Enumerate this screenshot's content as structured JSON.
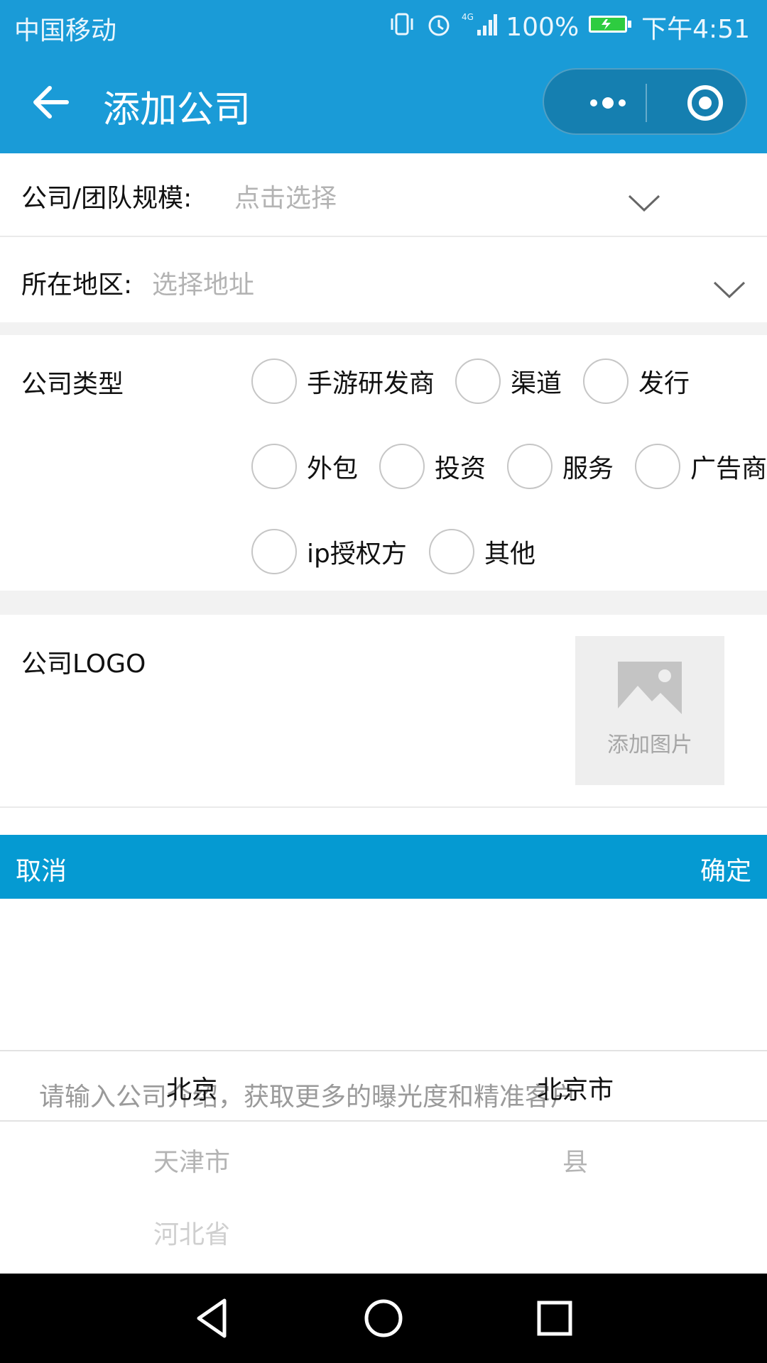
{
  "status_bar": {
    "carrier": "中国移动",
    "battery": "100%",
    "time": "下午4:51",
    "network": "4G",
    "colors": {
      "bar": "#1a9bd7",
      "battery_fill": "#2ecc40"
    },
    "icons": [
      "vibrate-icon",
      "alarm-icon",
      "signal-icon",
      "battery-icon"
    ]
  },
  "navbar": {
    "title": "添加公司",
    "icons": [
      "back-arrow-icon",
      "more-dots-icon",
      "close-target-icon"
    ]
  },
  "form": {
    "scale": {
      "label": "公司/团队规模:",
      "placeholder": "点击选择"
    },
    "region": {
      "label": "所在地区:",
      "placeholder": "选择地址"
    },
    "company_type": {
      "label": "公司类型",
      "options": [
        "手游研发商",
        "渠道",
        "发行",
        "外包",
        "投资",
        "服务",
        "广告商",
        "ip授权方",
        "其他"
      ]
    },
    "logo": {
      "label": "公司LOGO",
      "upload_text": "添加图片"
    },
    "intro_placeholder": "请输入公司介绍，获取更多的曝光度和精准客户"
  },
  "picker": {
    "cancel": "取消",
    "confirm": "确定",
    "accent": "#059ad2",
    "provinces": [
      "北京",
      "天津市",
      "河北省"
    ],
    "cities": [
      "北京市",
      "县"
    ]
  },
  "system_nav": {
    "icons": [
      "back-triangle-icon",
      "home-circle-icon",
      "recents-square-icon"
    ]
  }
}
